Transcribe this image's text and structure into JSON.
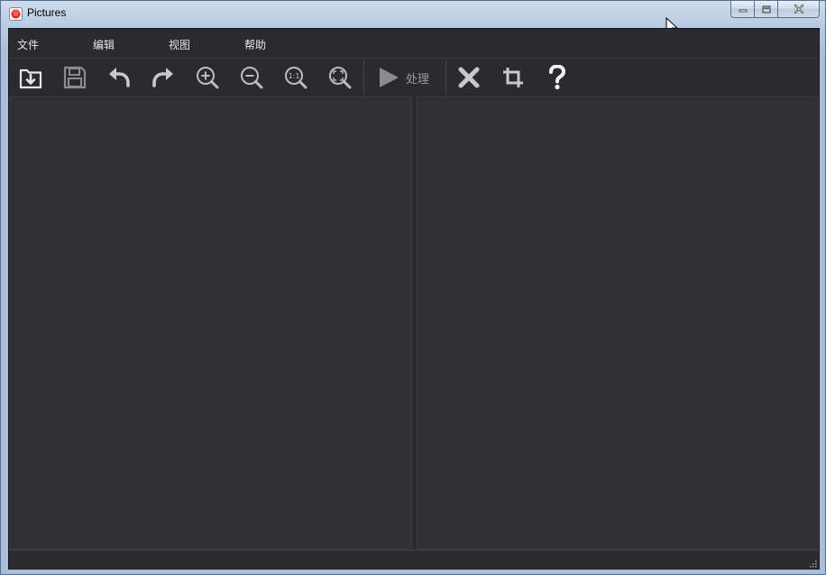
{
  "window": {
    "title": "Pictures",
    "icons": {
      "app": "app-icon",
      "minimize": "minimize-icon",
      "restore": "restore-icon",
      "close": "close-icon"
    }
  },
  "menubar": {
    "items": [
      {
        "label": "文件"
      },
      {
        "label": "编辑"
      },
      {
        "label": "视图"
      },
      {
        "label": "帮助"
      }
    ]
  },
  "toolbar": {
    "buttons": [
      {
        "icon": "open-folder-icon"
      },
      {
        "icon": "save-icon"
      },
      {
        "icon": "undo-icon"
      },
      {
        "icon": "redo-icon"
      },
      {
        "icon": "zoom-in-icon"
      },
      {
        "icon": "zoom-out-icon"
      },
      {
        "icon": "zoom-actual-size-icon",
        "text": "1:1"
      },
      {
        "icon": "zoom-fit-icon"
      },
      {
        "icon": "play-icon"
      },
      {
        "icon": "delete-icon"
      },
      {
        "icon": "crop-icon"
      },
      {
        "icon": "help-icon"
      }
    ],
    "process_label": "处理"
  },
  "colors": {
    "background": "#2e2d32",
    "pane": "#302f35",
    "icon": "#cfcfd2",
    "icon_dim": "#8c8c90",
    "menu_text": "#e6e6e6"
  }
}
